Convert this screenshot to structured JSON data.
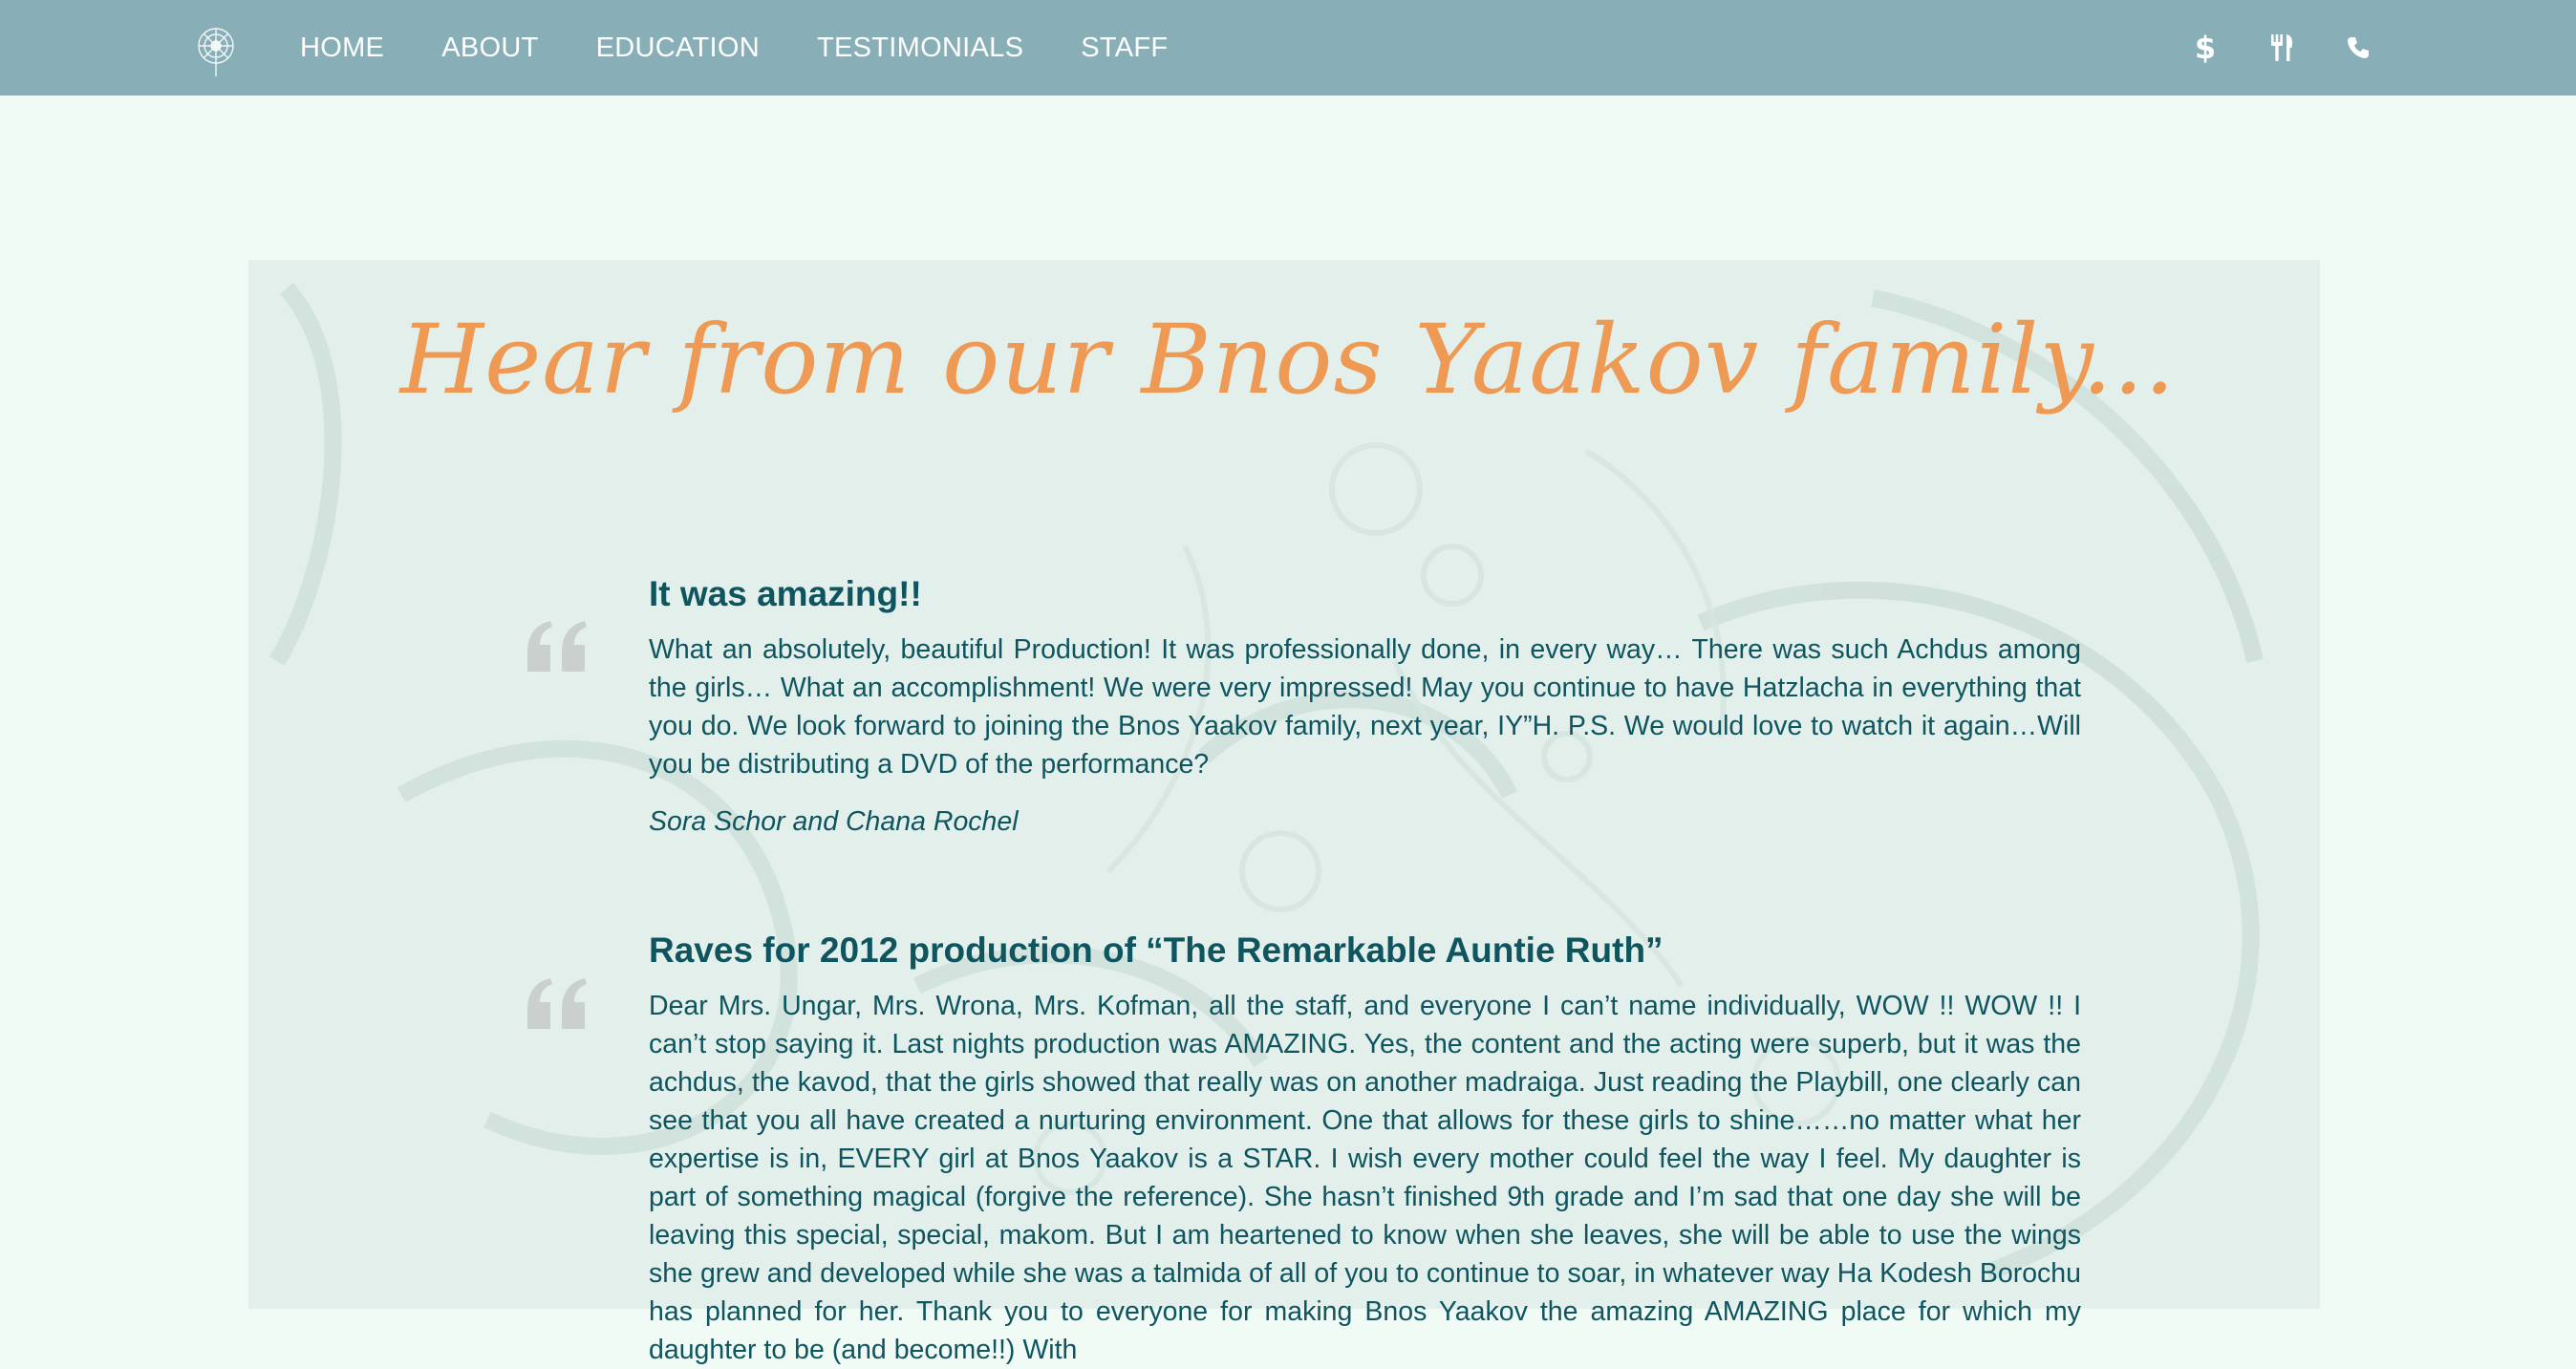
{
  "nav": {
    "links": [
      "HOME",
      "ABOUT",
      "EDUCATION",
      "TESTIMONIALS",
      "STAFF"
    ],
    "icons": [
      "dollar-icon",
      "utensils-icon",
      "phone-icon"
    ],
    "dollar_symbol": "$",
    "bar_color": "#88afb8"
  },
  "page": {
    "headline": "Hear from our Bnos Yaakov family...",
    "headline_color": "#ee9a55",
    "text_color": "#0e5560"
  },
  "testimonials": [
    {
      "title": "It was amazing!!",
      "body": "What an absolutely, beautiful Production! It was professionally done, in every way… There was such Achdus among the girls… What an accomplishment! We were very impressed! May you continue to have Hatzlacha in everything that you do. We look forward to joining the Bnos Yaakov family, next year, IY”H. P.S. We would love to watch it again…Will you be distributing a DVD of the performance?",
      "author": "Sora Schor and Chana Rochel"
    },
    {
      "title": "Raves for 2012 production of “The Remarkable Auntie Ruth”",
      "body": "Dear Mrs. Ungar, Mrs. Wrona, Mrs. Kofman, all the staff, and everyone I can’t name individually, WOW !! WOW !! I can’t stop saying it. Last nights production was AMAZING. Yes, the content and the acting were superb, but it was the achdus, the kavod, that the girls showed that really was on another madraiga. Just reading the Playbill, one clearly can see that you all have created a nurturing environment. One that allows for these girls to shine……no matter what her expertise is in, EVERY girl at Bnos Yaakov is a STAR. I wish every mother could feel the way I feel. My daughter is part of something magical (forgive the reference). She hasn’t finished 9th grade and I’m sad that one day she will be leaving this special, special, makom. But I am heartened to know when she leaves, she will be able to use the wings she grew and developed while she was a talmida of all of you to continue to soar, in whatever way Ha Kodesh Borochu has planned for her. Thank you to everyone for making Bnos Yaakov the amazing AMAZING place for which my daughter to be (and become!!) With"
    }
  ]
}
